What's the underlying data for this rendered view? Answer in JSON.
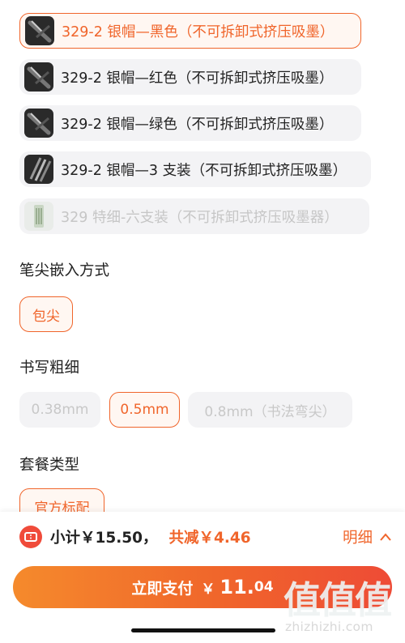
{
  "variants": [
    {
      "label": "329-2 银帽—黑色（不可拆卸式挤压吸墨）",
      "state": "selected",
      "thumb": "black-pen-thumb"
    },
    {
      "label": "329-2 银帽—红色（不可拆卸式挤压吸墨）",
      "state": "normal",
      "thumb": "red-pen-thumb"
    },
    {
      "label": "329-2 银帽—绿色（不可拆卸式挤压吸墨）",
      "state": "normal",
      "thumb": "green-pen-thumb"
    },
    {
      "label": "329-2 银帽—3 支装（不可拆卸式挤压吸墨）",
      "state": "normal",
      "thumb": "three-pens-thumb"
    },
    {
      "label": "329 特细-六支装（不可拆卸式挤压吸墨器）",
      "state": "disabled",
      "thumb": "six-pens-thumb"
    }
  ],
  "nib_section": {
    "title": "笔尖嵌入方式",
    "options": [
      {
        "label": "包尖",
        "state": "selected"
      }
    ]
  },
  "width_section": {
    "title": "书写粗细",
    "options": [
      {
        "label": "0.38mm",
        "state": "disabled"
      },
      {
        "label": "0.5mm",
        "state": "selected"
      },
      {
        "label": "0.8mm（书法弯尖）",
        "state": "disabled"
      }
    ]
  },
  "package_section": {
    "title": "套餐类型",
    "options": [
      {
        "label": "官方标配",
        "state": "selected"
      }
    ]
  },
  "footer": {
    "subtotal": "小计￥15.50，",
    "discount": "共减￥4.46",
    "detail_label": "明细",
    "pay_label": "立即支付",
    "pay_currency": "￥",
    "pay_integer": "11.",
    "pay_decimal": "04"
  },
  "watermark": {
    "logo": "值值值",
    "url": "zhizhizhi.com"
  },
  "colors": {
    "accent": "#f0652b",
    "option_bg": "#f3f3f5",
    "disabled_text": "#c6c6c6"
  }
}
